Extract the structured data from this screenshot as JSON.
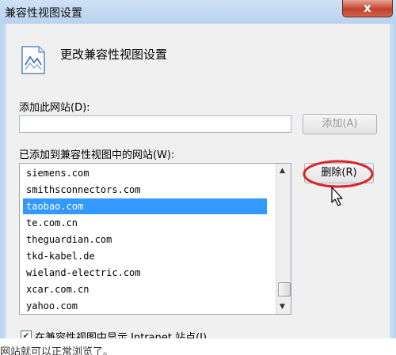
{
  "window": {
    "title": "兼容性视图设置",
    "close_label": "x"
  },
  "header": {
    "text": "更改兼容性视图设置",
    "icon": "document-chart-icon"
  },
  "add_section": {
    "label": "添加此网站(D):",
    "input_value": "",
    "add_button_label": "添加(A)"
  },
  "list_section": {
    "label": "已添加到兼容性视图中的网站(W):",
    "items": [
      "siemens.com",
      "smithsconnectors.com",
      "taobao.com",
      "te.com.cn",
      "theguardian.com",
      "tkd-kabel.de",
      "wieland-electric.com",
      "xcar.com.cn",
      "yahoo.com"
    ],
    "selected_index": 2,
    "remove_button_label": "删除(R)"
  },
  "options": {
    "intranet_label": "在兼容性视图中显示 Intranet 站点(I)",
    "intranet_checked": true
  },
  "caption": "网站就可以正常浏览了。",
  "colors": {
    "selection": "#3399ff",
    "highlight_ring": "#d9252a"
  }
}
